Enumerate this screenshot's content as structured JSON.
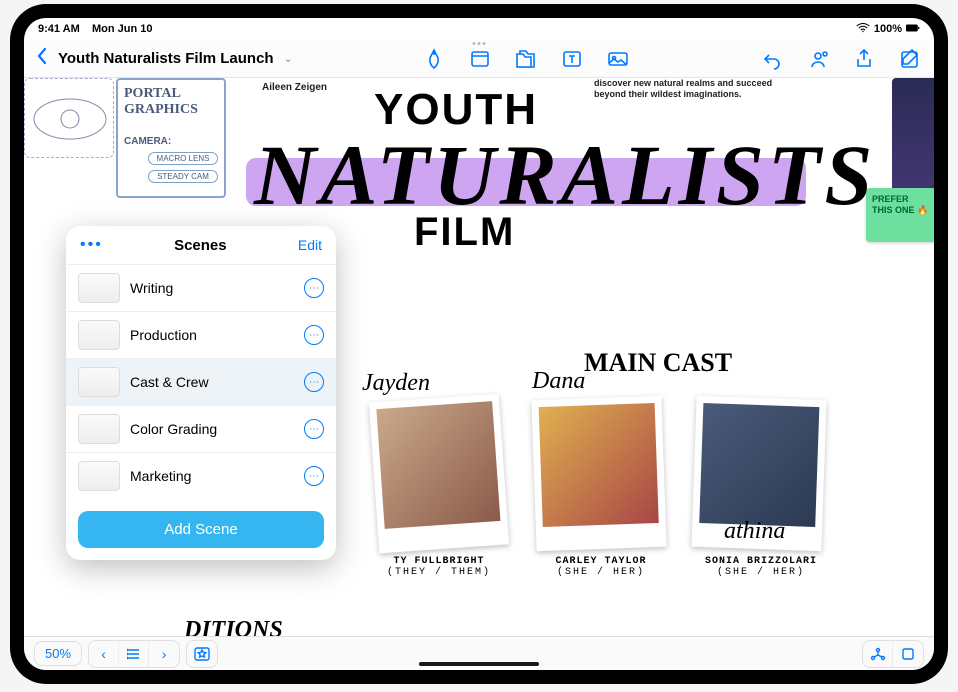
{
  "status_bar": {
    "time": "9:41 AM",
    "date": "Mon Jun 10",
    "battery_pct": "100%"
  },
  "toolbar": {
    "title": "Youth Naturalists Film Launch"
  },
  "canvas_top": {
    "credit": "Aileen Zeigen",
    "blurb": "discover new natural realms and succeed beyond their wildest imaginations."
  },
  "title_art": {
    "line1": "YOUTH",
    "line2": "NATURALISTS",
    "line3": "FILM"
  },
  "sketch_box": {
    "title": "PORTAL GRAPHICS",
    "camera_label": "CAMERA:",
    "chip1": "MACRO LENS",
    "chip2": "STEADY CAM"
  },
  "sticky_note": {
    "text": "PREFER THIS ONE 🔥"
  },
  "main_cast_label": "MAIN CAST",
  "cast": [
    {
      "sig": "Jayden",
      "name": "TY FULLBRIGHT",
      "pronoun": "(THEY / THEM)"
    },
    {
      "sig": "Dana",
      "name": "CARLEY TAYLOR",
      "pronoun": "(SHE / HER)"
    },
    {
      "sig": "athina",
      "name": "SONIA BRIZZOLARI",
      "pronoun": "(SHE / HER)"
    }
  ],
  "conditions_label": "DITIONS",
  "scenes_panel": {
    "title": "Scenes",
    "edit": "Edit",
    "items": [
      {
        "label": "Writing"
      },
      {
        "label": "Production"
      },
      {
        "label": "Cast & Crew"
      },
      {
        "label": "Color Grading"
      },
      {
        "label": "Marketing"
      }
    ],
    "add_label": "Add Scene"
  },
  "bottom_bar": {
    "zoom": "50%"
  }
}
